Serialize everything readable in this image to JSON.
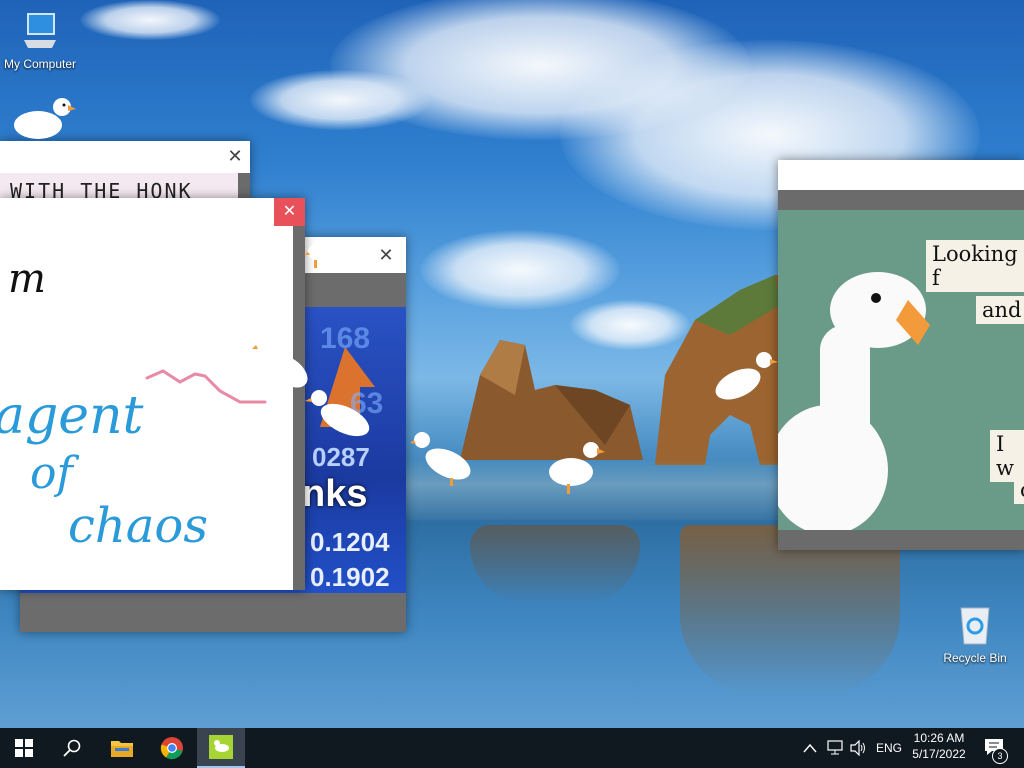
{
  "desktop": {
    "icons": [
      {
        "label": "My Computer",
        "icon": "computer-icon"
      },
      {
        "label": "Recycle Bin",
        "icon": "recycle-bin-icon"
      }
    ]
  },
  "windows": {
    "honk_note": {
      "text": "WITH THE HONK"
    },
    "chaos_note": {
      "line1": "m",
      "line2": "agent",
      "line3": "of",
      "line4": "chaos"
    },
    "stocks_meme": {
      "numbers": [
        "168",
        "63",
        "0287",
        "0.1204",
        "0.1902"
      ],
      "word": "nks"
    },
    "goose_meme": {
      "line1": "Looking f",
      "line2": "and",
      "line3": "I w",
      "line4": "c"
    }
  },
  "taskbar": {
    "pinned": [
      {
        "name": "start-button",
        "icon": "windows-logo-icon"
      },
      {
        "name": "search-button",
        "icon": "search-icon"
      },
      {
        "name": "file-explorer-button",
        "icon": "folder-icon"
      },
      {
        "name": "chrome-button",
        "icon": "chrome-icon"
      },
      {
        "name": "goose-app-button",
        "icon": "goose-app-icon"
      }
    ],
    "tray": {
      "language": "ENG",
      "time": "10:26 AM",
      "date": "5/17/2022",
      "notification_count": "3"
    }
  },
  "colors": {
    "taskbar": "#101820",
    "close_hover": "#e81123",
    "meme_green": "#6a9a88",
    "goose_beak": "#f39a3a"
  }
}
